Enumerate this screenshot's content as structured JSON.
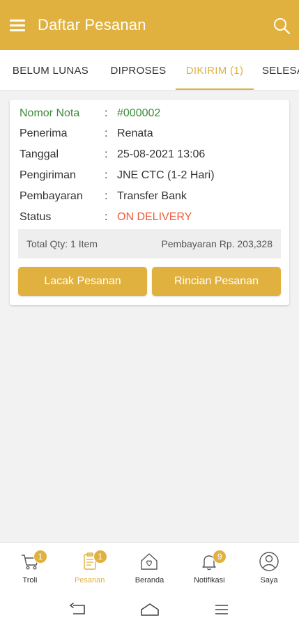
{
  "header": {
    "title": "Daftar Pesanan"
  },
  "tabs": [
    {
      "label": "BELUM LUNAS"
    },
    {
      "label": "DIPROSES"
    },
    {
      "label": "DIKIRIM (1)"
    },
    {
      "label": "SELESAI"
    }
  ],
  "order": {
    "rows": [
      {
        "label": "Nomor Nota",
        "value": "#000002"
      },
      {
        "label": "Penerima",
        "value": "Renata"
      },
      {
        "label": "Tanggal",
        "value": "25-08-2021 13:06"
      },
      {
        "label": "Pengiriman",
        "value": "JNE CTC (1-2 Hari)"
      },
      {
        "label": "Pembayaran",
        "value": "Transfer Bank"
      },
      {
        "label": "Status",
        "value": "ON DELIVERY"
      }
    ],
    "separator": ":",
    "total_qty": "Total Qty: 1 Item",
    "payment_total": "Pembayaran Rp. 203,328",
    "track_button": "Lacak Pesanan",
    "detail_button": "Rincian Pesanan"
  },
  "bottom_nav": [
    {
      "label": "Troli",
      "badge": "1",
      "icon": "cart-icon"
    },
    {
      "label": "Pesanan",
      "badge": "1",
      "icon": "clipboard-icon"
    },
    {
      "label": "Beranda",
      "badge": "",
      "icon": "home-icon"
    },
    {
      "label": "Notifikasi",
      "badge": "9",
      "icon": "bell-icon"
    },
    {
      "label": "Saya",
      "badge": "",
      "icon": "user-icon"
    }
  ],
  "colors": {
    "accent": "#e0b13e",
    "status_red": "#f05a3a",
    "nota_green": "#3b8a3b"
  }
}
